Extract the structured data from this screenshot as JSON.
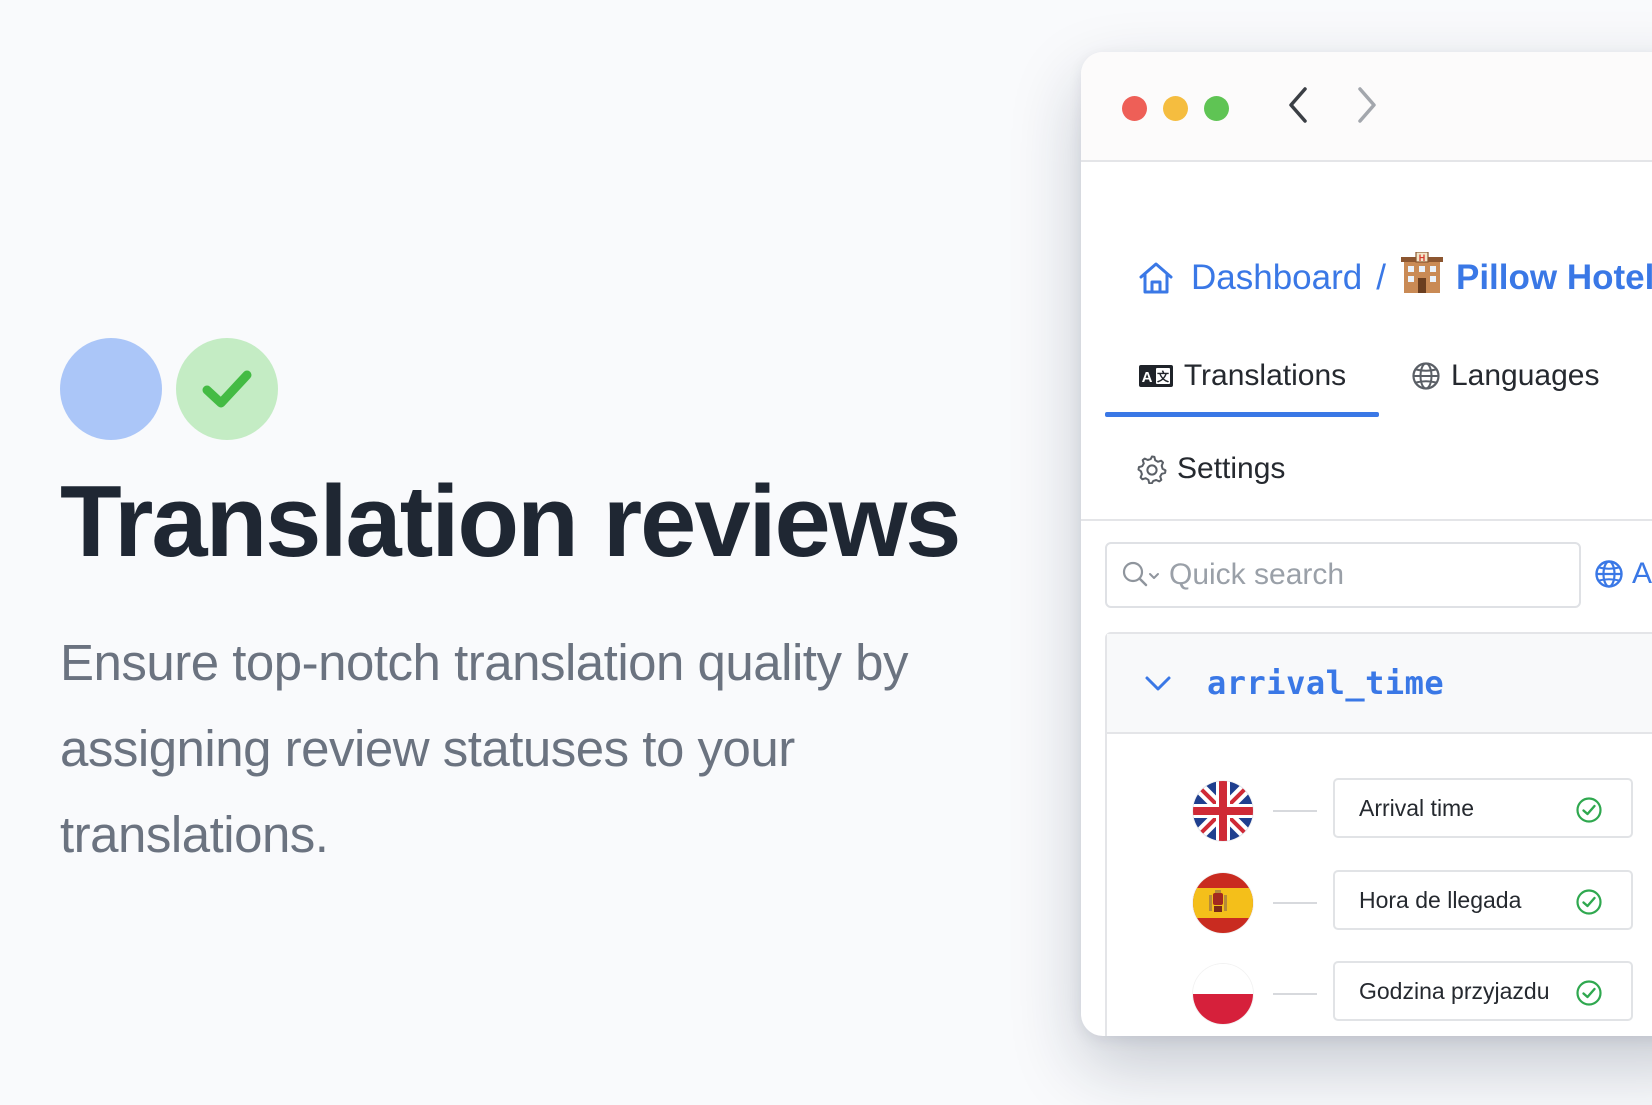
{
  "hero": {
    "headline": "Translation reviews",
    "subcopy": "Ensure top-notch translation quality by assigning review statuses to your translations.",
    "colors": {
      "blue_circle": "#abc6f8",
      "green_circle": "#c4ecc4",
      "check": "#44bb44"
    }
  },
  "window": {
    "breadcrumb": {
      "home_label": "Dashboard",
      "separator": "/",
      "project_label": "Pillow Hotel"
    },
    "tabs": [
      {
        "label": "Translations",
        "icon": "translate-icon",
        "active": true
      },
      {
        "label": "Languages",
        "icon": "globe-icon",
        "active": false
      }
    ],
    "settings_label": "Settings",
    "search": {
      "placeholder": "Quick search",
      "value": ""
    },
    "language_filter_label": "A",
    "key": {
      "name": "arrival_time",
      "expanded": true,
      "translations": [
        {
          "language": "English (United Kingdom)",
          "flag": "uk-flag",
          "text": "Arrival time",
          "status": "reviewed"
        },
        {
          "language": "Spanish",
          "flag": "spain-flag",
          "text": "Hora de llegada",
          "status": "reviewed"
        },
        {
          "language": "Polish",
          "flag": "poland-flag",
          "text": "Godzina przyjazdu",
          "status": "reviewed"
        }
      ]
    },
    "accent_color": "#3a78e6",
    "reviewed_color": "#2fa84f"
  }
}
